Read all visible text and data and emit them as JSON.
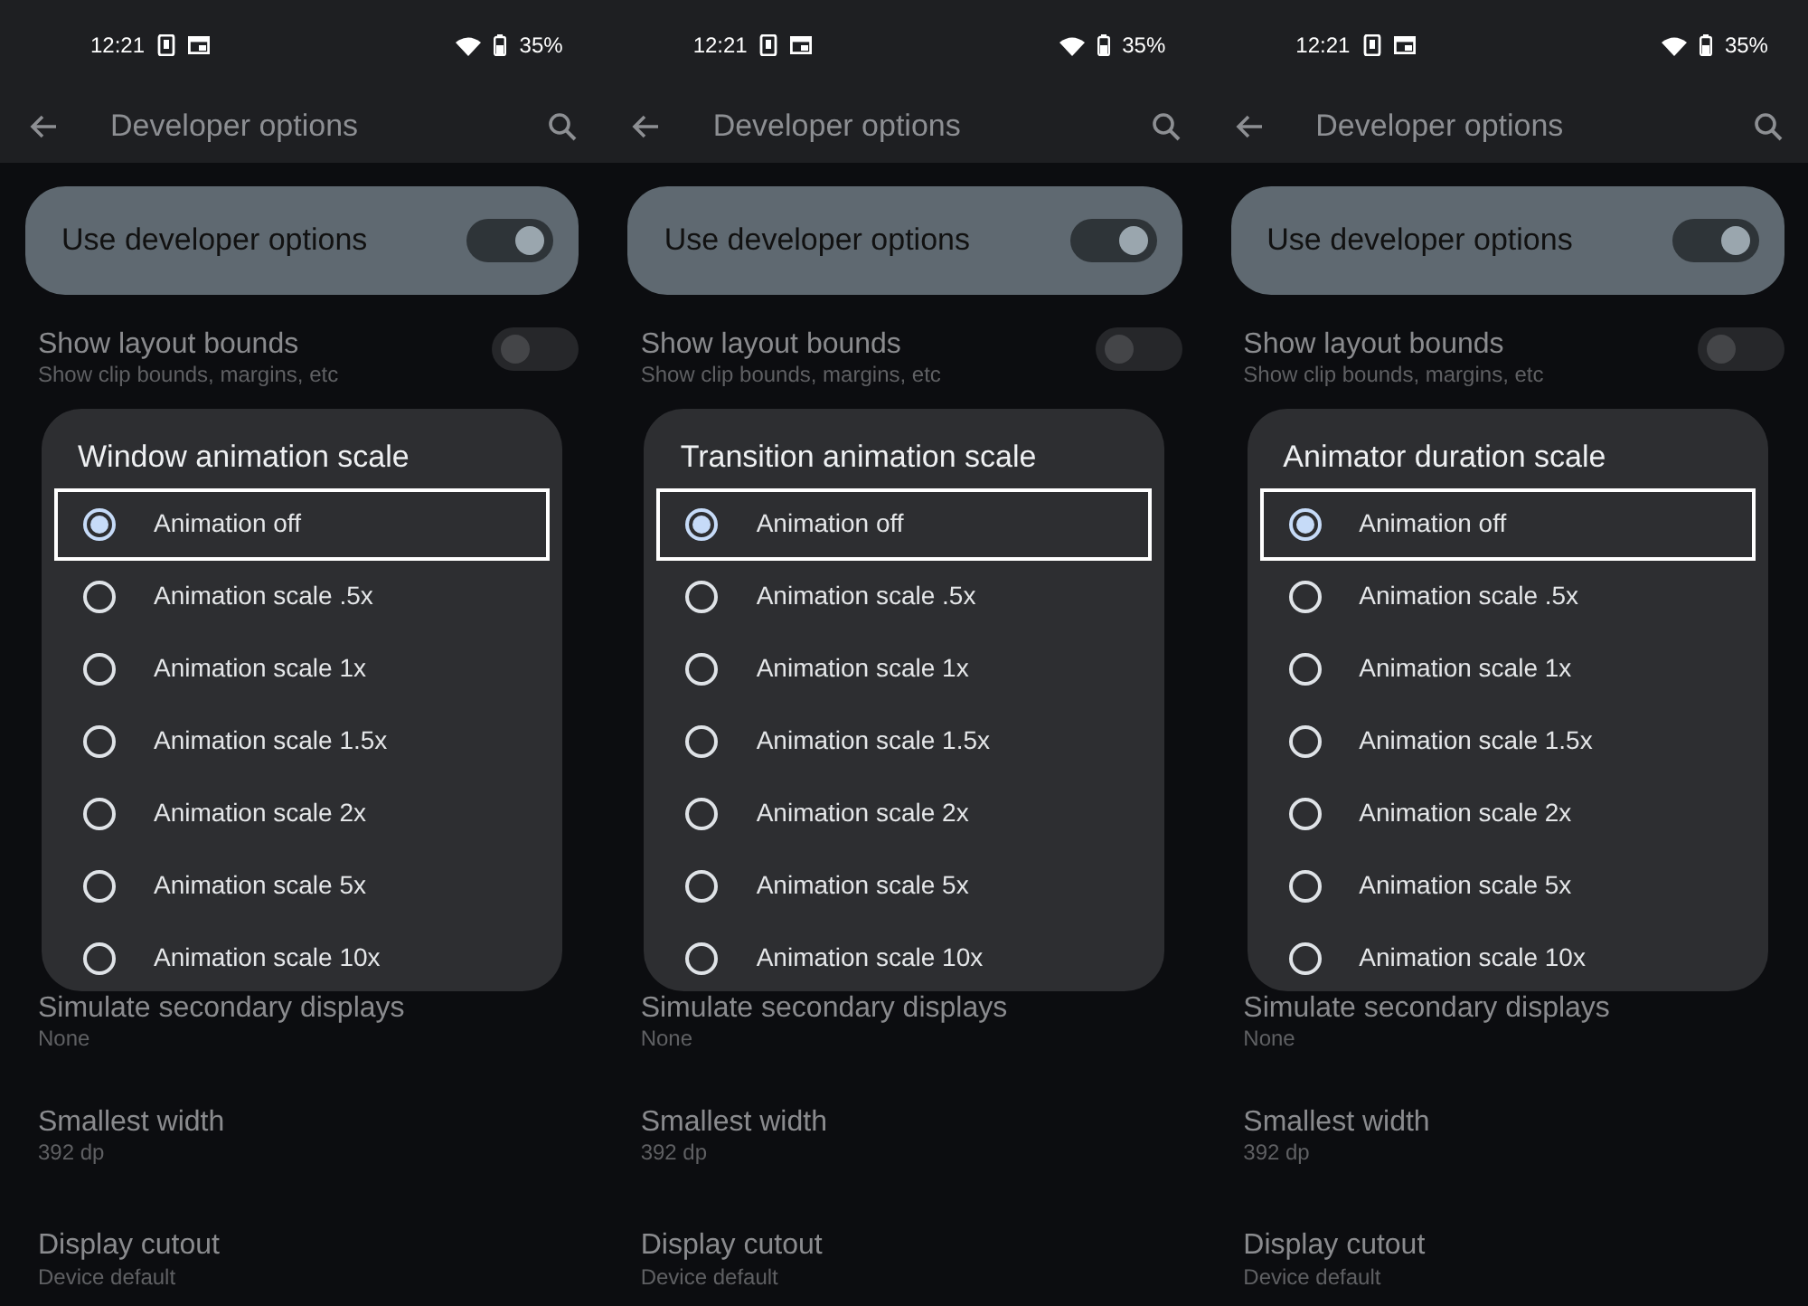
{
  "panels": [
    {
      "status_bar": {
        "time": "12:21",
        "battery": "35%"
      },
      "app_bar": {
        "title": "Developer options"
      },
      "main_switch": {
        "label": "Use developer options",
        "on": true
      },
      "settings": [
        {
          "title": "Show layout bounds",
          "subtitle": "Show clip bounds, margins, etc",
          "kind": "toggle",
          "on": false
        },
        {
          "title": "Simulate secondary displays",
          "subtitle": "None",
          "kind": "value"
        },
        {
          "title": "Smallest width",
          "subtitle": "392 dp",
          "kind": "value"
        },
        {
          "title": "Display cutout",
          "subtitle": "Device default",
          "kind": "value"
        }
      ],
      "dialog": {
        "title": "Window animation scale",
        "options": [
          {
            "label": "Animation off",
            "selected": true,
            "highlighted": true
          },
          {
            "label": "Animation scale .5x",
            "selected": false,
            "highlighted": false
          },
          {
            "label": "Animation scale 1x",
            "selected": false,
            "highlighted": false
          },
          {
            "label": "Animation scale 1.5x",
            "selected": false,
            "highlighted": false
          },
          {
            "label": "Animation scale 2x",
            "selected": false,
            "highlighted": false
          },
          {
            "label": "Animation scale 5x",
            "selected": false,
            "highlighted": false
          },
          {
            "label": "Animation scale 10x",
            "selected": false,
            "highlighted": false
          }
        ]
      }
    },
    {
      "status_bar": {
        "time": "12:21",
        "battery": "35%"
      },
      "app_bar": {
        "title": "Developer options"
      },
      "main_switch": {
        "label": "Use developer options",
        "on": true
      },
      "settings": [
        {
          "title": "Show layout bounds",
          "subtitle": "Show clip bounds, margins, etc",
          "kind": "toggle",
          "on": false
        },
        {
          "title": "Simulate secondary displays",
          "subtitle": "None",
          "kind": "value"
        },
        {
          "title": "Smallest width",
          "subtitle": "392 dp",
          "kind": "value"
        },
        {
          "title": "Display cutout",
          "subtitle": "Device default",
          "kind": "value"
        }
      ],
      "dialog": {
        "title": "Transition animation scale",
        "options": [
          {
            "label": "Animation off",
            "selected": true,
            "highlighted": true
          },
          {
            "label": "Animation scale .5x",
            "selected": false,
            "highlighted": false
          },
          {
            "label": "Animation scale 1x",
            "selected": false,
            "highlighted": false
          },
          {
            "label": "Animation scale 1.5x",
            "selected": false,
            "highlighted": false
          },
          {
            "label": "Animation scale 2x",
            "selected": false,
            "highlighted": false
          },
          {
            "label": "Animation scale 5x",
            "selected": false,
            "highlighted": false
          },
          {
            "label": "Animation scale 10x",
            "selected": false,
            "highlighted": false
          }
        ]
      }
    },
    {
      "status_bar": {
        "time": "12:21",
        "battery": "35%"
      },
      "app_bar": {
        "title": "Developer options"
      },
      "main_switch": {
        "label": "Use developer options",
        "on": true
      },
      "settings": [
        {
          "title": "Show layout bounds",
          "subtitle": "Show clip bounds, margins, etc",
          "kind": "toggle",
          "on": false
        },
        {
          "title": "Simulate secondary displays",
          "subtitle": "None",
          "kind": "value"
        },
        {
          "title": "Smallest width",
          "subtitle": "392 dp",
          "kind": "value"
        },
        {
          "title": "Display cutout",
          "subtitle": "Device default",
          "kind": "value"
        }
      ],
      "dialog": {
        "title": "Animator duration scale",
        "options": [
          {
            "label": "Animation off",
            "selected": true,
            "highlighted": true
          },
          {
            "label": "Animation scale .5x",
            "selected": false,
            "highlighted": false
          },
          {
            "label": "Animation scale 1x",
            "selected": false,
            "highlighted": false
          },
          {
            "label": "Animation scale 1.5x",
            "selected": false,
            "highlighted": false
          },
          {
            "label": "Animation scale 2x",
            "selected": false,
            "highlighted": false
          },
          {
            "label": "Animation scale 5x",
            "selected": false,
            "highlighted": false
          },
          {
            "label": "Animation scale 10x",
            "selected": false,
            "highlighted": false
          }
        ]
      }
    }
  ]
}
